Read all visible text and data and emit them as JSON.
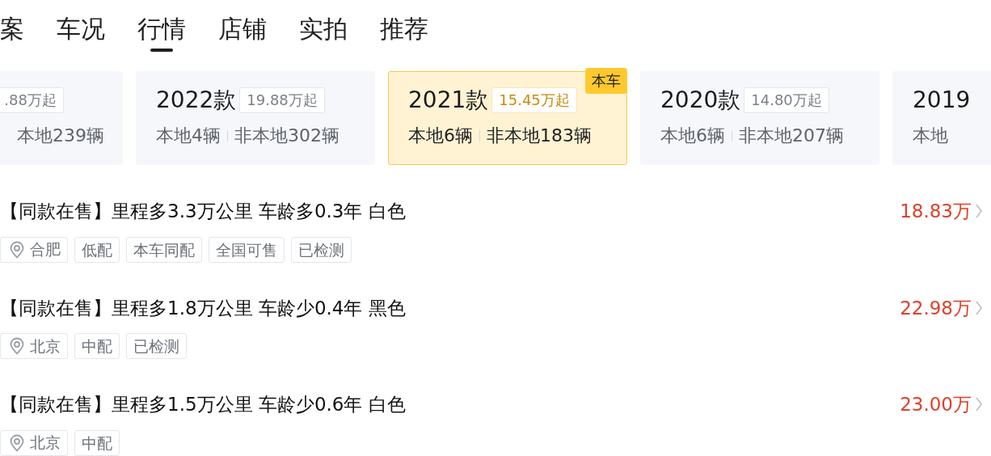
{
  "tabs": [
    {
      "label": "案",
      "selected": false
    },
    {
      "label": "车况",
      "selected": false
    },
    {
      "label": "行情",
      "selected": true
    },
    {
      "label": "店铺",
      "selected": false
    },
    {
      "label": "实拍",
      "selected": false
    },
    {
      "label": "推荐",
      "selected": false
    }
  ],
  "model_years": [
    {
      "price": ".88万起",
      "nonlocal": "本地239辆",
      "selected": false
    },
    {
      "year": "2022款",
      "price": "19.88万起",
      "local": "本地4辆",
      "nonlocal": "非本地302辆",
      "selected": false
    },
    {
      "year": "2021款",
      "price": "15.45万起",
      "local": "本地6辆",
      "nonlocal": "非本地183辆",
      "selected": true,
      "badge": "本车"
    },
    {
      "year": "2020款",
      "price": "14.80万起",
      "local": "本地6辆",
      "nonlocal": "非本地207辆",
      "selected": false
    },
    {
      "year": "2019",
      "local": "本地",
      "selected": false
    }
  ],
  "listings": [
    {
      "title": "【同款在售】里程多3.3万公里 车龄多0.3年 白色",
      "price": "18.83万",
      "city": "合肥",
      "tags": [
        "低配",
        "本车同配",
        "全国可售",
        "已检测"
      ]
    },
    {
      "title": "【同款在售】里程多1.8万公里 车龄少0.4年 黑色",
      "price": "22.98万",
      "city": "北京",
      "tags": [
        "中配",
        "已检测"
      ]
    },
    {
      "title": "【同款在售】里程多1.5万公里 车龄少0.6年 白色",
      "price": "23.00万",
      "city": "北京",
      "tags": [
        "中配"
      ]
    }
  ]
}
